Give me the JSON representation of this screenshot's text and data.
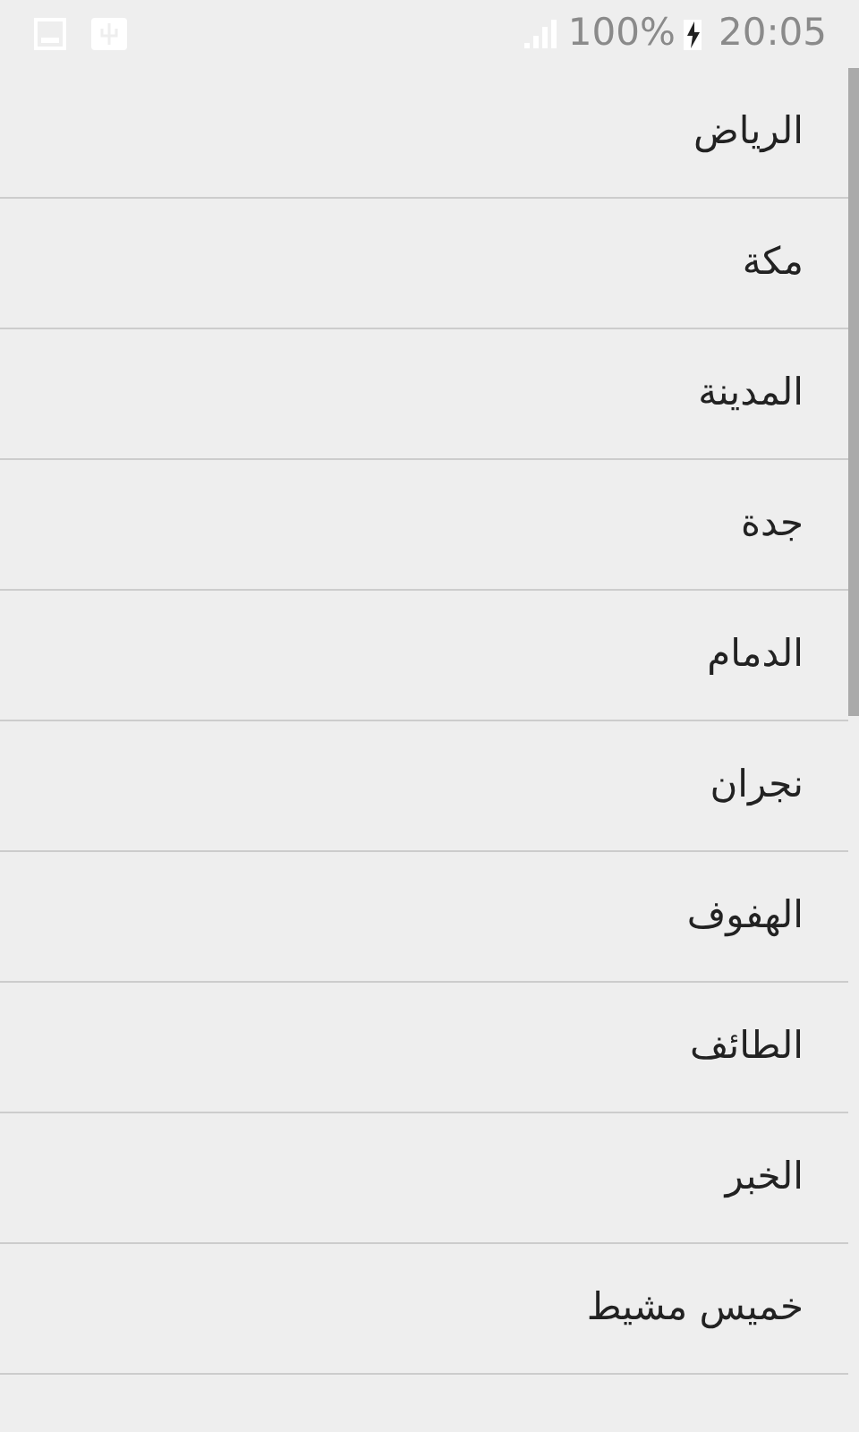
{
  "status_bar": {
    "battery": "100%",
    "time": "20:05"
  },
  "cities": [
    "الرياض",
    "مكة",
    "المدينة",
    "جدة",
    "الدمام",
    "نجران",
    "الهفوف",
    "الطائف",
    "الخبر",
    "خميس مشيط"
  ]
}
